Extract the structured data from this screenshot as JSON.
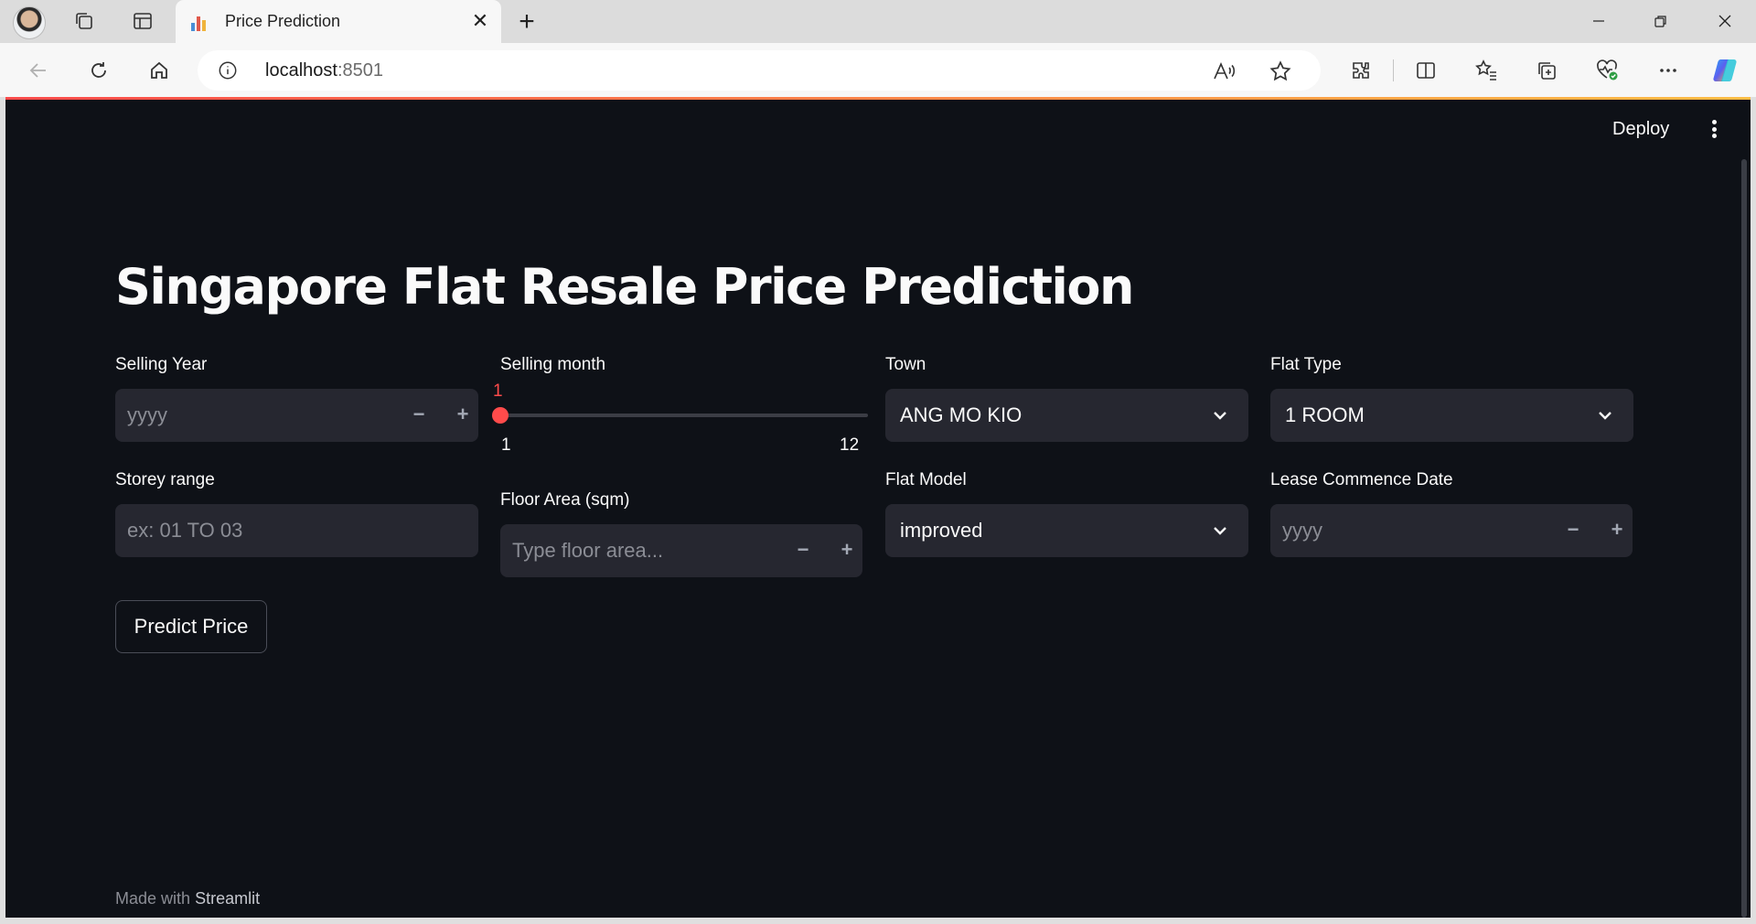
{
  "browser": {
    "tab_title": "Price Prediction",
    "url_host": "localhost",
    "url_port": ":8501"
  },
  "app": {
    "deploy_label": "Deploy",
    "title": "Singapore Flat Resale Price Prediction",
    "selling_year": {
      "label": "Selling Year",
      "placeholder": "yyyy"
    },
    "selling_month": {
      "label": "Selling month",
      "value": "1",
      "min": "1",
      "max": "12"
    },
    "town": {
      "label": "Town",
      "value": "ANG MO KIO"
    },
    "flat_type": {
      "label": "Flat Type",
      "value": "1 ROOM"
    },
    "storey_range": {
      "label": "Storey range",
      "placeholder": "ex: 01 TO 03"
    },
    "floor_area": {
      "label": "Floor Area (sqm)",
      "placeholder": "Type floor area..."
    },
    "flat_model": {
      "label": "Flat Model",
      "value": "improved"
    },
    "lease_commence": {
      "label": "Lease Commence Date",
      "placeholder": "yyyy"
    },
    "predict_button": "Predict Price",
    "footer": {
      "prefix": "Made with",
      "brand": "Streamlit"
    }
  },
  "colors": {
    "app_bg": "#0e1117",
    "input_bg": "#262730",
    "accent": "#ff4b4b",
    "text": "#fafafa",
    "placeholder": "#8b8d95"
  }
}
